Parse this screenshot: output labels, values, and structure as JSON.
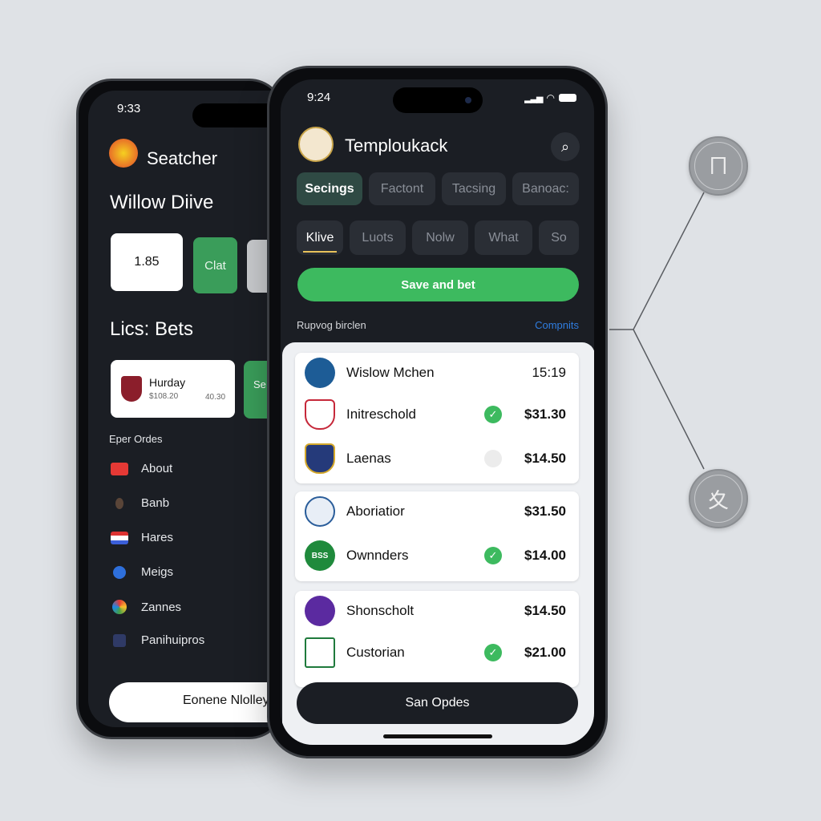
{
  "back_phone": {
    "time": "9:33",
    "app_title": "Seatcher",
    "heading": "Willow Diive",
    "tiles": [
      "1.85",
      "Clat"
    ],
    "section": "Lics: Bets",
    "bet_card": {
      "name": "Hurday",
      "amount": "$108.20",
      "odds": "40.30",
      "side_label": "Se"
    },
    "list_title": "Eper Ordes",
    "list": [
      {
        "label": "About",
        "icon": "youtube-icon"
      },
      {
        "label": "Banb",
        "icon": "avatar-icon"
      },
      {
        "label": "Hares",
        "icon": "flag-icon"
      },
      {
        "label": "Meigs",
        "icon": "blue-badge-icon"
      },
      {
        "label": "Zannes",
        "icon": "chrome-icon"
      },
      {
        "label": "Panihuipros",
        "icon": "app-icon"
      }
    ],
    "bottom_button": "Eonene Nlolley"
  },
  "front_phone": {
    "time": "9:24",
    "app_title": "Temploukack",
    "tabs": [
      {
        "label": "Secings",
        "active": true
      },
      {
        "label": "Factont"
      },
      {
        "label": "Tacsing"
      },
      {
        "label": "Banoac:"
      }
    ],
    "subtabs": [
      {
        "label": "Klive",
        "active": true
      },
      {
        "label": "Luots"
      },
      {
        "label": "Nolw"
      },
      {
        "label": "What"
      },
      {
        "label": "So"
      }
    ],
    "primary_button": "Save and bet",
    "section_label": "Rupvog birclen",
    "section_link": "Compnits",
    "groups": [
      [
        {
          "name": "Wislow Mchen",
          "value": "15:19",
          "status": "none"
        },
        {
          "name": "Initreschold",
          "value": "$31.30",
          "status": "checked"
        },
        {
          "name": "Laenas",
          "value": "$14.50",
          "status": "unchecked"
        }
      ],
      [
        {
          "name": "Aboriatior",
          "value": "$31.50",
          "status": "none"
        },
        {
          "name": "Ownnders",
          "value": "$14.00",
          "status": "checked",
          "logo_text": "BSS"
        }
      ],
      [
        {
          "name": "Shonscholt",
          "value": "$14.50",
          "status": "none"
        },
        {
          "name": "Custorian",
          "value": "$21.00",
          "status": "checked"
        }
      ]
    ],
    "bottom_button": "San Opdes"
  },
  "colors": {
    "accent_green": "#3dba5f",
    "link_blue": "#2f7de0",
    "dark": "#1b1e24",
    "tab_active": "#2f4a44",
    "underline": "#e8c25a"
  }
}
